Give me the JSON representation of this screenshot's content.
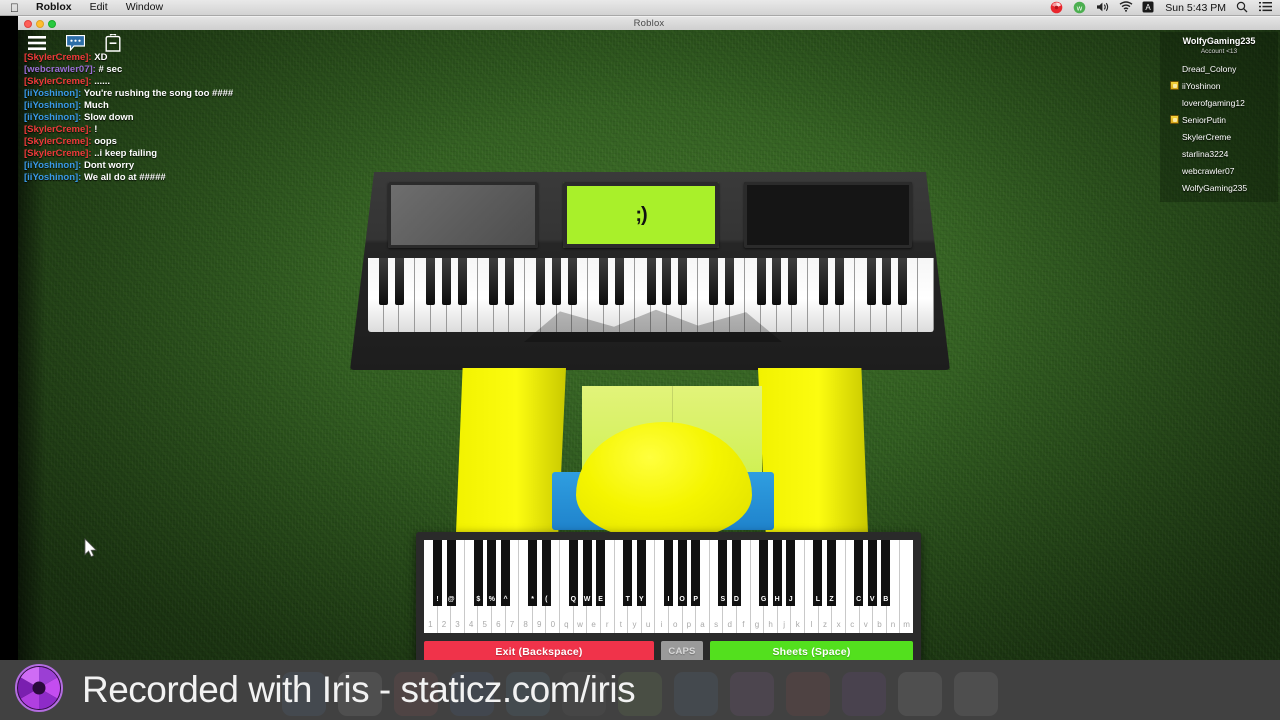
{
  "menubar": {
    "apple_icon": "apple-icon",
    "items": [
      {
        "label": "Roblox",
        "bold": true
      },
      {
        "label": "Edit",
        "bold": false
      },
      {
        "label": "Window",
        "bold": false
      }
    ],
    "status_icons": [
      "iris-shutter-icon",
      "whatsapp-icon",
      "volume-icon",
      "wifi-icon",
      "input-source-icon"
    ],
    "clock": "Sun 5:43 PM",
    "right_icons": [
      "search-icon",
      "notification-center-icon"
    ]
  },
  "window": {
    "title": "Roblox",
    "traffic_lights": [
      "close-button",
      "minimize-button",
      "zoom-button"
    ]
  },
  "topbar": {
    "buttons": [
      {
        "name": "menu-icon",
        "label": "Menu"
      },
      {
        "name": "chat-icon",
        "label": "Chat"
      },
      {
        "name": "backpack-icon",
        "label": "Backpack"
      }
    ]
  },
  "colors": {
    "name_red": "#ee3b3b",
    "name_blue": "#3a9ae8",
    "name_purple": "#9b6fd6",
    "message_white": "#ffffff",
    "exit_button": "#f0334a",
    "caps_button": "#9a9a9a",
    "sheets_button": "#53e01e",
    "lcd_screen": "#a9f02a",
    "avatar_yellow": "#f5f500",
    "avatar_pants_blue": "#1f83cc"
  },
  "chat": {
    "lines": [
      {
        "name": "",
        "message": "",
        "color": "#ffffff",
        "faded": true
      },
      {
        "name": "[SkylerCreme]:",
        "message": "XD",
        "color": "#ee3b3b",
        "faded": false
      },
      {
        "name": "[webcrawler07]:",
        "message": "# sec",
        "color": "#9b6fd6",
        "faded": false
      },
      {
        "name": "[SkylerCreme]:",
        "message": "......",
        "color": "#ee3b3b",
        "faded": false
      },
      {
        "name": "[iiYoshinon]:",
        "message": "You're rushing the song too ####",
        "color": "#3a9ae8",
        "faded": false
      },
      {
        "name": "[iiYoshinon]:",
        "message": "Much",
        "color": "#3a9ae8",
        "faded": false
      },
      {
        "name": "[iiYoshinon]:",
        "message": "Slow down",
        "color": "#3a9ae8",
        "faded": false
      },
      {
        "name": "[SkylerCreme]:",
        "message": "!",
        "color": "#ee3b3b",
        "faded": false
      },
      {
        "name": "[SkylerCreme]:",
        "message": "oops",
        "color": "#ee3b3b",
        "faded": false
      },
      {
        "name": "[SkylerCreme]:",
        "message": "..i keep failing",
        "color": "#ee3b3b",
        "faded": false
      },
      {
        "name": "[iiYoshinon]:",
        "message": "Dont worry",
        "color": "#3a9ae8",
        "faded": false
      },
      {
        "name": "[iiYoshinon]:",
        "message": "We all do at #####",
        "color": "#3a9ae8",
        "faded": false
      }
    ]
  },
  "playerlist": {
    "header_name": "WolfyGaming235",
    "header_account": "Account <13",
    "players": [
      {
        "name": "Dread_Colony",
        "badge": false
      },
      {
        "name": "iiYoshinon",
        "badge": true
      },
      {
        "name": "loverofgaming12",
        "badge": false
      },
      {
        "name": "SeniorPutin",
        "badge": true
      },
      {
        "name": "SkylerCreme",
        "badge": false
      },
      {
        "name": "starlina3224",
        "badge": false
      },
      {
        "name": "webcrawler07",
        "badge": false
      },
      {
        "name": "WolfyGaming235",
        "badge": false
      }
    ]
  },
  "instrument": {
    "lcd_text": ";)",
    "panels": [
      "gray-display-panel",
      "lcd-screen-panel",
      "black-speaker-panel"
    ]
  },
  "piano_gui": {
    "white_key_labels": [
      "1",
      "2",
      "3",
      "4",
      "5",
      "6",
      "7",
      "8",
      "9",
      "0",
      "q",
      "w",
      "e",
      "r",
      "t",
      "y",
      "u",
      "i",
      "o",
      "p",
      "a",
      "s",
      "d",
      "f",
      "g",
      "h",
      "j",
      "k",
      "l",
      "z",
      "x",
      "c",
      "v",
      "b",
      "n",
      "m"
    ],
    "black_keys": [
      {
        "label": "!",
        "after": 0
      },
      {
        "label": "@",
        "after": 1
      },
      {
        "label": "$",
        "after": 3
      },
      {
        "label": "%",
        "after": 4
      },
      {
        "label": "^",
        "after": 5
      },
      {
        "label": "*",
        "after": 7
      },
      {
        "label": "(",
        "after": 8
      },
      {
        "label": "Q",
        "after": 10
      },
      {
        "label": "W",
        "after": 11
      },
      {
        "label": "E",
        "after": 12
      },
      {
        "label": "T",
        "after": 14
      },
      {
        "label": "Y",
        "after": 15
      },
      {
        "label": "I",
        "after": 17
      },
      {
        "label": "O",
        "after": 18
      },
      {
        "label": "P",
        "after": 19
      },
      {
        "label": "S",
        "after": 21
      },
      {
        "label": "D",
        "after": 22
      },
      {
        "label": "G",
        "after": 24
      },
      {
        "label": "H",
        "after": 25
      },
      {
        "label": "J",
        "after": 26
      },
      {
        "label": "L",
        "after": 28
      },
      {
        "label": "Z",
        "after": 29
      },
      {
        "label": "C",
        "after": 31
      },
      {
        "label": "V",
        "after": 32
      },
      {
        "label": "B",
        "after": 33
      }
    ],
    "buttons": {
      "exit": "Exit (Backspace)",
      "caps": "CAPS",
      "sheets": "Sheets (Space)"
    }
  },
  "watermark": {
    "text": "Recorded with Iris - staticz.com/iris",
    "logo": "iris-aperture-logo"
  },
  "dock": {
    "icons": [
      "finder-icon",
      "launchpad-icon",
      "calendar-icon",
      "app-store-icon",
      "safari-icon",
      "dashboard-icon",
      "photos-icon",
      "mail-icon",
      "itunes-icon",
      "roblox-icon",
      "iris-icon",
      "finder-window-icon",
      "trash-icon"
    ]
  }
}
